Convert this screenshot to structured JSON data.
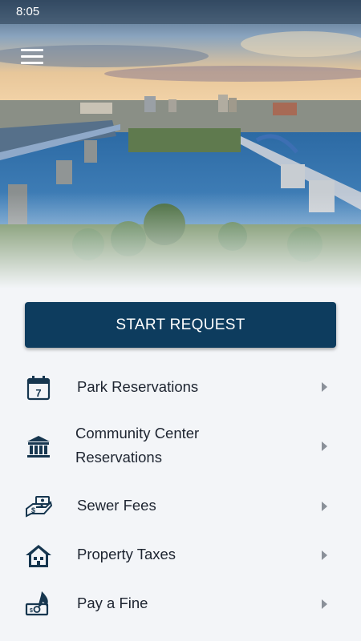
{
  "status_bar": {
    "time": "8:05"
  },
  "header": {
    "menu_icon": "hamburger-icon"
  },
  "actions": {
    "start_request_label": "START REQUEST"
  },
  "menu": {
    "items": [
      {
        "label": "Park Reservations",
        "icon": "calendar-icon"
      },
      {
        "label_line1": "Community Center",
        "label_line2": "Reservations",
        "icon": "building-icon"
      },
      {
        "label": "Sewer Fees",
        "icon": "hand-money-icon"
      },
      {
        "label": "Property Taxes",
        "icon": "house-icon"
      },
      {
        "label": "Pay a Fine",
        "icon": "money-fire-icon"
      }
    ]
  },
  "colors": {
    "primary": "#0d3c5e",
    "icon": "#16364f",
    "background": "#f3f5f8"
  }
}
